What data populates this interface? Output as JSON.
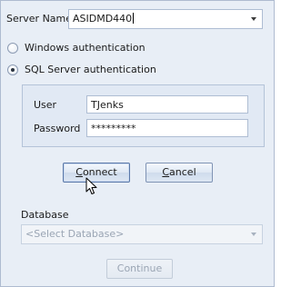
{
  "server": {
    "label": "Server Name",
    "value": "ASIDMD440"
  },
  "auth": {
    "windows_label": "Windows authentication",
    "sql_label": "SQL Server authentication",
    "selected": "sql"
  },
  "credentials": {
    "user_label": "User",
    "user_value": "TJenks",
    "password_label": "Password",
    "password_value": "*********"
  },
  "buttons": {
    "connect_first": "C",
    "connect_rest": "onnect",
    "cancel_first": "C",
    "cancel_rest": "ancel",
    "continue_label": "Continue"
  },
  "database": {
    "label": "Database",
    "placeholder": "<Select Database>"
  },
  "icons": {
    "dropdown": "chevron-down-icon",
    "cursor": "mouse-pointer-icon"
  },
  "colors": {
    "dialog_bg": "#e8eef6",
    "group_bg": "#e1e9f4",
    "border": "#aebdd3"
  }
}
